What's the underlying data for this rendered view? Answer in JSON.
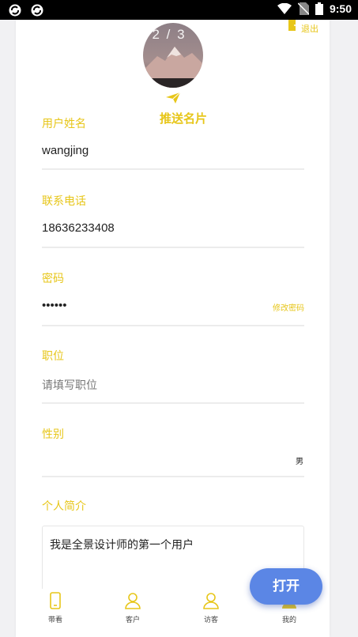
{
  "status_bar": {
    "time": "9:50"
  },
  "header": {
    "avatar_counter": "2 / 3",
    "push_card_label": "推送名片",
    "logout_label": "退出"
  },
  "form": {
    "username": {
      "label": "用户姓名",
      "value": "wangjing"
    },
    "phone": {
      "label": "联系电话",
      "value": "18636233408"
    },
    "password": {
      "label": "密码",
      "value": "••••••",
      "change_label": "修改密码"
    },
    "position": {
      "label": "职位",
      "placeholder": "请填写职位"
    },
    "gender": {
      "label": "性别",
      "value": "男"
    },
    "bio": {
      "label": "个人简介",
      "value": "我是全景设计师的第一个用户"
    }
  },
  "tabbar": {
    "items": [
      {
        "label": "带看",
        "icon": "phone-icon"
      },
      {
        "label": "客户",
        "icon": "user-icon"
      },
      {
        "label": "访客",
        "icon": "visitor-icon"
      },
      {
        "label": "我的",
        "icon": "profile-icon"
      }
    ]
  },
  "open_button": {
    "label": "打开"
  },
  "colors": {
    "accent": "#e7c619",
    "open_button": "#5b86e5",
    "background": "#f1f1f3"
  }
}
